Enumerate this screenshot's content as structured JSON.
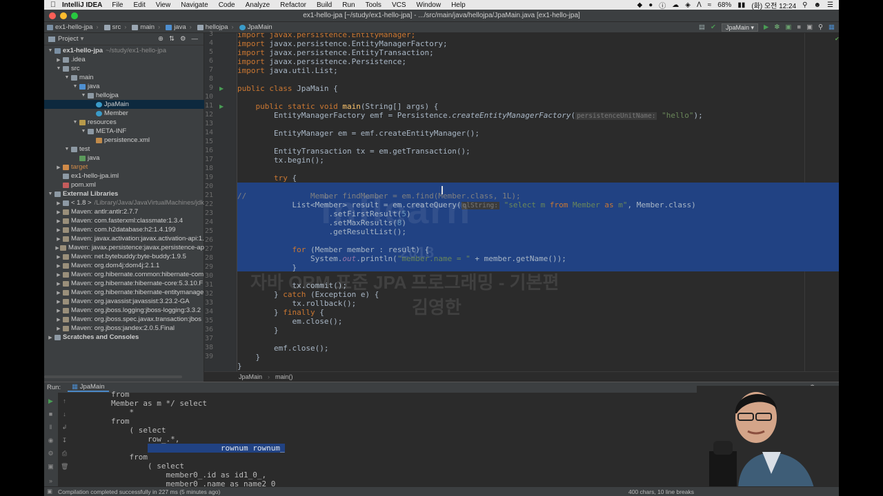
{
  "menubar": {
    "app": "IntelliJ IDEA",
    "items": [
      "File",
      "Edit",
      "View",
      "Navigate",
      "Code",
      "Analyze",
      "Refactor",
      "Build",
      "Run",
      "Tools",
      "VCS",
      "Window",
      "Help"
    ],
    "battery": "68%",
    "clock": "(화) 오전 12:24"
  },
  "window": {
    "title": "ex1-hello-jpa [~/study/ex1-hello-jpa] - .../src/main/java/hellojpa/JpaMain.java [ex1-hello-jpa]"
  },
  "breadcrumbs": [
    "ex1-hello-jpa",
    "src",
    "main",
    "java",
    "hellojpa",
    "JpaMain"
  ],
  "toolbar": {
    "run_config": "JpaMain"
  },
  "project": {
    "title": "Project",
    "tree": [
      {
        "label": "ex1-hello-jpa",
        "extra": "~/study/ex1-hello-jpa",
        "depth": 0,
        "arrow": "open",
        "icon": "module"
      },
      {
        "label": ".idea",
        "depth": 1,
        "arrow": "closed",
        "icon": "folder"
      },
      {
        "label": "src",
        "depth": 1,
        "arrow": "open",
        "icon": "folder"
      },
      {
        "label": "main",
        "depth": 2,
        "arrow": "open",
        "icon": "folder"
      },
      {
        "label": "java",
        "depth": 3,
        "arrow": "open",
        "icon": "source-folder"
      },
      {
        "label": "hellojpa",
        "depth": 4,
        "arrow": "open",
        "icon": "package"
      },
      {
        "label": "JpaMain",
        "depth": 5,
        "arrow": "none",
        "icon": "class",
        "selected": true
      },
      {
        "label": "Member",
        "depth": 5,
        "arrow": "none",
        "icon": "class"
      },
      {
        "label": "resources",
        "depth": 3,
        "arrow": "open",
        "icon": "resource-folder"
      },
      {
        "label": "META-INF",
        "depth": 4,
        "arrow": "open",
        "icon": "folder"
      },
      {
        "label": "persistence.xml",
        "depth": 5,
        "arrow": "none",
        "icon": "xml"
      },
      {
        "label": "test",
        "depth": 2,
        "arrow": "open",
        "icon": "folder"
      },
      {
        "label": "java",
        "depth": 3,
        "arrow": "none",
        "icon": "test-folder"
      },
      {
        "label": "target",
        "depth": 1,
        "arrow": "closed",
        "icon": "excluded-folder"
      },
      {
        "label": "ex1-hello-jpa.iml",
        "depth": 1,
        "arrow": "none",
        "icon": "iml"
      },
      {
        "label": "pom.xml",
        "depth": 1,
        "arrow": "none",
        "icon": "maven"
      },
      {
        "label": "External Libraries",
        "depth": 0,
        "arrow": "open",
        "icon": "library"
      },
      {
        "label": "< 1.8 >",
        "extra": "/Library/Java/JavaVirtualMachines/jdk",
        "depth": 1,
        "arrow": "closed",
        "icon": "jdk"
      },
      {
        "label": "Maven: antlr:antlr:2.7.7",
        "depth": 1,
        "arrow": "closed",
        "icon": "jar"
      },
      {
        "label": "Maven: com.fasterxml:classmate:1.3.4",
        "depth": 1,
        "arrow": "closed",
        "icon": "jar"
      },
      {
        "label": "Maven: com.h2database:h2:1.4.199",
        "depth": 1,
        "arrow": "closed",
        "icon": "jar"
      },
      {
        "label": "Maven: javax.activation:javax.activation-api:1.",
        "depth": 1,
        "arrow": "closed",
        "icon": "jar"
      },
      {
        "label": "Maven: javax.persistence:javax.persistence-ap",
        "depth": 1,
        "arrow": "closed",
        "icon": "jar"
      },
      {
        "label": "Maven: net.bytebuddy:byte-buddy:1.9.5",
        "depth": 1,
        "arrow": "closed",
        "icon": "jar"
      },
      {
        "label": "Maven: org.dom4j:dom4j:2.1.1",
        "depth": 1,
        "arrow": "closed",
        "icon": "jar"
      },
      {
        "label": "Maven: org.hibernate.common:hibernate-com",
        "depth": 1,
        "arrow": "closed",
        "icon": "jar"
      },
      {
        "label": "Maven: org.hibernate:hibernate-core:5.3.10.F",
        "depth": 1,
        "arrow": "closed",
        "icon": "jar"
      },
      {
        "label": "Maven: org.hibernate:hibernate-entitymanage",
        "depth": 1,
        "arrow": "closed",
        "icon": "jar"
      },
      {
        "label": "Maven: org.javassist:javassist:3.23.2-GA",
        "depth": 1,
        "arrow": "closed",
        "icon": "jar"
      },
      {
        "label": "Maven: org.jboss.logging:jboss-logging:3.3.2",
        "depth": 1,
        "arrow": "closed",
        "icon": "jar"
      },
      {
        "label": "Maven: org.jboss.spec.javax.transaction:jbos",
        "depth": 1,
        "arrow": "closed",
        "icon": "jar"
      },
      {
        "label": "Maven: org.jboss:jandex:2.0.5.Final",
        "depth": 1,
        "arrow": "closed",
        "icon": "jar"
      },
      {
        "label": "Scratches and Consoles",
        "depth": 0,
        "arrow": "closed",
        "icon": "scratch"
      }
    ]
  },
  "editor": {
    "line_numbers": [
      "3",
      "4",
      "5",
      "6",
      "7",
      "8",
      "9",
      "10",
      "11",
      "12",
      "13",
      "14",
      "15",
      "16",
      "17",
      "18",
      "19",
      "20",
      "21",
      "22",
      "23",
      "24",
      "25",
      "26",
      "27",
      "28",
      "29",
      "30",
      "31",
      "32",
      "33",
      "34",
      "35",
      "36",
      "37",
      "38",
      "39"
    ],
    "code": {
      "l3": "import javax.persistence.EntityManager;",
      "l4_a": "import ",
      "l4_b": "javax.persistence.EntityManagerFactory;",
      "l5_b": "javax.persistence.EntityTransaction;",
      "l6_b": "javax.persistence.Persistence;",
      "l7_b": "java.util.List;",
      "l9_a": "public class ",
      "l9_b": "JpaMain {",
      "l11_a": "    public static void ",
      "l11_fn": "main",
      "l11_b": "(String[] args) {",
      "l12_a": "        EntityManagerFactory emf = Persistence.",
      "l12_m": "createEntityManagerFactory",
      "l12_p": "(",
      "l12_hint": "persistenceUnitName:",
      "l12_s": "\"hello\"",
      "l12_e": ");",
      "l14": "        EntityManager em = emf.createEntityManager();",
      "l16": "        EntityTransaction tx = em.getTransaction();",
      "l17": "        tx.begin();",
      "l19_k": "try",
      "l19_e": " {",
      "l21": "//              Member findMember = em.find(Member.class, 1L);",
      "l22_a": "            List<Member> result = em.createQuery(",
      "l22_hint": "qlString:",
      "l22_s1": "\"select m ",
      "l22_k": "from",
      "l22_s2": " Member ",
      "l22_k2": "as",
      "l22_s3": " m\"",
      "l22_e": ", Member.class)",
      "l23_a": "                    .setFirstResult(",
      "l23_n": "5",
      "l23_e": ")",
      "l24_a": "                    .setMaxResults(",
      "l24_n": "8",
      "l24_e": ")",
      "l25": "                    .getResultList();",
      "l27_k": "for",
      "l27_e": " (Member member : result) {",
      "l28_a": "                System.",
      "l28_f": "out",
      "l28_b": ".println(",
      "l28_s": "\"member.name = \"",
      "l28_e": " + member.getName());",
      "l29": "            }",
      "l31": "            tx.commit();",
      "l32_a": "        } ",
      "l32_k": "catch",
      "l32_e": " (Exception e) {",
      "l33": "            tx.rollback();",
      "l34_a": "        } ",
      "l34_k": "finally",
      "l34_e": " {",
      "l35": "            em.close();",
      "l36": "        }",
      "l38": "        emf.close();",
      "l39": "    }",
      "l40": "}"
    }
  },
  "editor_breadcrumb": [
    "JpaMain",
    "main()"
  ],
  "watermark": {
    "line1": "inflearn",
    "line2": "2018",
    "line3": "자바 ORM 표준 JPA 프로그래밍 - 기본편",
    "line4": "김영한"
  },
  "run": {
    "label": "Run:",
    "tab": "JpaMain",
    "output": [
      "        from",
      "        Member as m */ select",
      "            *",
      "        from",
      "            ( select",
      "                row_.*,",
      "                rownum rownum_",
      "            from",
      "                ( select",
      "                    member0_.id as id1_0_,",
      "                    member0_.name as name2_0_"
    ]
  },
  "status": {
    "left": "Compilation completed successfully in 227 ms (5 minutes ago)",
    "right": "400 chars, 10 line breaks"
  },
  "colors": {
    "keyword": "#cc7832",
    "string": "#6a8759",
    "function": "#ffc66d",
    "selection": "#214283",
    "run_green": "#499c54"
  }
}
